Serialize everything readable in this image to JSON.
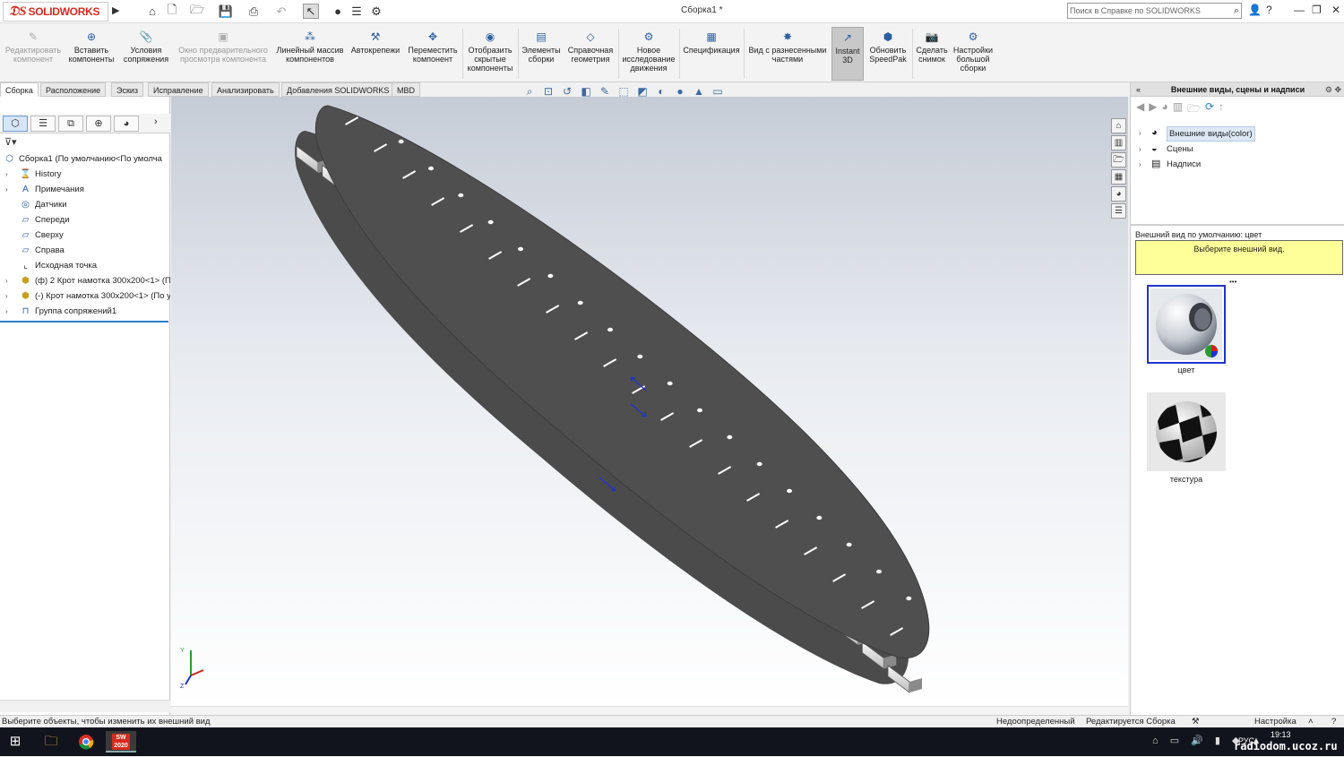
{
  "app": {
    "logo_text": "SOLIDWORKS",
    "document_title": "Сборка1 *",
    "search_placeholder": "Поиск в Справке по SOLIDWORKS"
  },
  "ribbon": {
    "buttons": [
      {
        "label": "Редактировать компонент",
        "icon": "edit-component-icon",
        "disabled": true
      },
      {
        "label": "Вставить компоненты",
        "icon": "insert-components-icon",
        "disabled": false
      },
      {
        "label": "Условия сопряжения",
        "icon": "mate-icon",
        "disabled": false
      },
      {
        "label": "Окно предварительного просмотра компонента",
        "icon": "component-preview-icon",
        "disabled": true
      },
      {
        "label": "Линейный массив компонентов",
        "icon": "linear-pattern-icon",
        "disabled": false
      },
      {
        "label": "Автокрепежи",
        "icon": "smart-fasteners-icon",
        "disabled": false
      },
      {
        "label": "Переместить компонент",
        "icon": "move-component-icon",
        "disabled": false
      },
      {
        "label": "Отобразить скрытые компоненты",
        "icon": "show-hidden-icon",
        "disabled": false
      },
      {
        "label": "Элементы сборки",
        "icon": "assembly-features-icon",
        "disabled": false
      },
      {
        "label": "Справочная геометрия",
        "icon": "reference-geometry-icon",
        "disabled": false
      },
      {
        "label": "Новое исследование движения",
        "icon": "motion-study-icon",
        "disabled": false
      },
      {
        "label": "Спецификация",
        "icon": "bom-icon",
        "disabled": false
      },
      {
        "label": "Вид с разнесенными частями",
        "icon": "exploded-view-icon",
        "disabled": false
      },
      {
        "label": "Instant 3D",
        "icon": "instant3d-icon",
        "disabled": false,
        "active": true
      },
      {
        "label": "Обновить SpeedPak",
        "icon": "speedpak-icon",
        "disabled": false
      },
      {
        "label": "Сделать снимок",
        "icon": "snapshot-icon",
        "disabled": false
      },
      {
        "label": "Настройки большой сборки",
        "icon": "large-assembly-icon",
        "disabled": false
      }
    ]
  },
  "tabs": [
    "Сборка",
    "Расположение",
    "Эскиз",
    "Исправление",
    "Анализировать",
    "Добавления SOLIDWORKS",
    "MBD"
  ],
  "tree": {
    "root": "Сборка1  (По умолчанию<По умолча",
    "items": [
      {
        "label": "History",
        "icon": "history-icon",
        "expand": true
      },
      {
        "label": "Примечания",
        "icon": "annotations-icon",
        "expand": true
      },
      {
        "label": "Датчики",
        "icon": "sensors-icon",
        "expand": false
      },
      {
        "label": "Спереди",
        "icon": "plane-icon",
        "expand": false
      },
      {
        "label": "Сверху",
        "icon": "plane-icon",
        "expand": false
      },
      {
        "label": "Справа",
        "icon": "plane-icon",
        "expand": false
      },
      {
        "label": "Исходная точка",
        "icon": "origin-icon",
        "expand": false
      },
      {
        "label": "(ф) 2 Крот намотка 300х200<1> (По",
        "icon": "part-icon",
        "expand": true
      },
      {
        "label": "(-) Крот намотка 300х200<1> (По у",
        "icon": "part-icon",
        "expand": true
      },
      {
        "label": "Группа сопряжений1",
        "icon": "mates-group-icon",
        "expand": true
      }
    ]
  },
  "taskpane": {
    "title": "Внешние виды, сцены и надписи",
    "items": [
      "Внешние виды(color)",
      "Сцены",
      "Надписи"
    ],
    "default_label": "Внешний вид по умолчанию: цвет",
    "hint": "Выберите внешний вид.",
    "thumbs": [
      "цвет",
      "текстура"
    ]
  },
  "status": {
    "left": "Выберите объекты, чтобы изменить их внешний вид",
    "state": "Недоопределенный",
    "editing": "Редактируется Сборка",
    "settings": "Настройка"
  },
  "taskbar": {
    "lang": "РУС",
    "time": "19:13",
    "watermark": "radiodom.ucoz.ru",
    "app_badge": "2020"
  },
  "colors": {
    "brand": "#d52b1e",
    "accent": "#2d7fc9",
    "part_dark": "#4a4a4a"
  }
}
